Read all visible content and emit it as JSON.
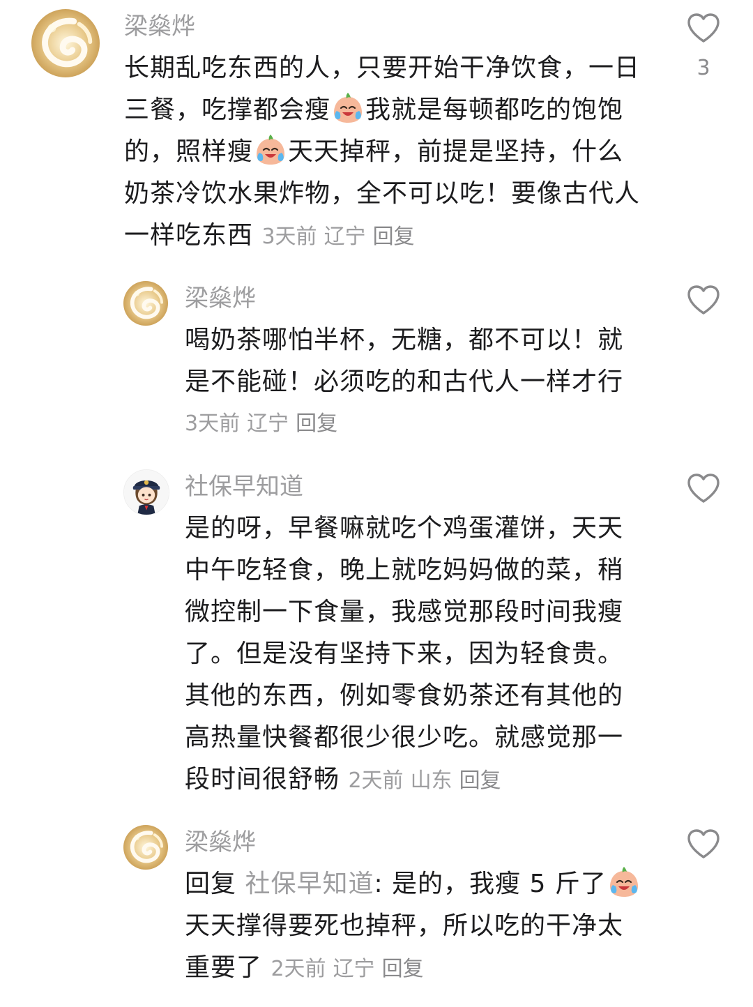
{
  "comments": [
    {
      "username": "梁燊烨",
      "avatar_icon": "golden-swirl-avatar",
      "text_parts": [
        "长期乱吃东西的人，只要开始干净饮食，一日三餐，吃撑都会瘦",
        "我就是每顿都吃的饱饱的，照样瘦",
        "天天掉秤，前提是坚持，什么奶茶冷饮水果炸物，全不可以吃！要像古代人一样吃东西"
      ],
      "time": "3天前",
      "location": "辽宁",
      "reply_label": "回复",
      "like_count": "3"
    },
    {
      "username": "梁燊烨",
      "avatar_icon": "golden-swirl-avatar",
      "text": "喝奶茶哪怕半杯，无糖，都不可以！就是不能碰！必须吃的和古代人一样才行",
      "time": "3天前",
      "location": "辽宁",
      "reply_label": "回复"
    },
    {
      "username": "社保早知道",
      "avatar_icon": "cartoon-officer-avatar",
      "text": "是的呀，早餐嘛就吃个鸡蛋灌饼，天天中午吃轻食，晚上就吃妈妈做的菜，稍微控制一下食量，我感觉那段时间我瘦了。但是没有坚持下来，因为轻食贵。其他的东西，例如零食奶茶还有其他的高热量快餐都很少很少吃。就感觉那一段时间很舒畅",
      "time": "2天前",
      "location": "山东",
      "reply_label": "回复"
    },
    {
      "username": "梁燊烨",
      "avatar_icon": "golden-swirl-avatar",
      "reply_prefix": "回复",
      "mention": "社保早知道",
      "text_parts": [
        ": 是的，我瘦 5 斤了",
        "天天撑得要死也掉秤，所以吃的干净太重要了"
      ],
      "time": "2天前",
      "location": "辽宁",
      "reply_label": "回复"
    }
  ],
  "icons": {
    "like": "heart-outline-icon",
    "emoji": "crying-laughing-emoji"
  },
  "colors": {
    "text": "#1c1c1e",
    "meta": "#9d9d9f",
    "icon": "#8a8a8c"
  }
}
